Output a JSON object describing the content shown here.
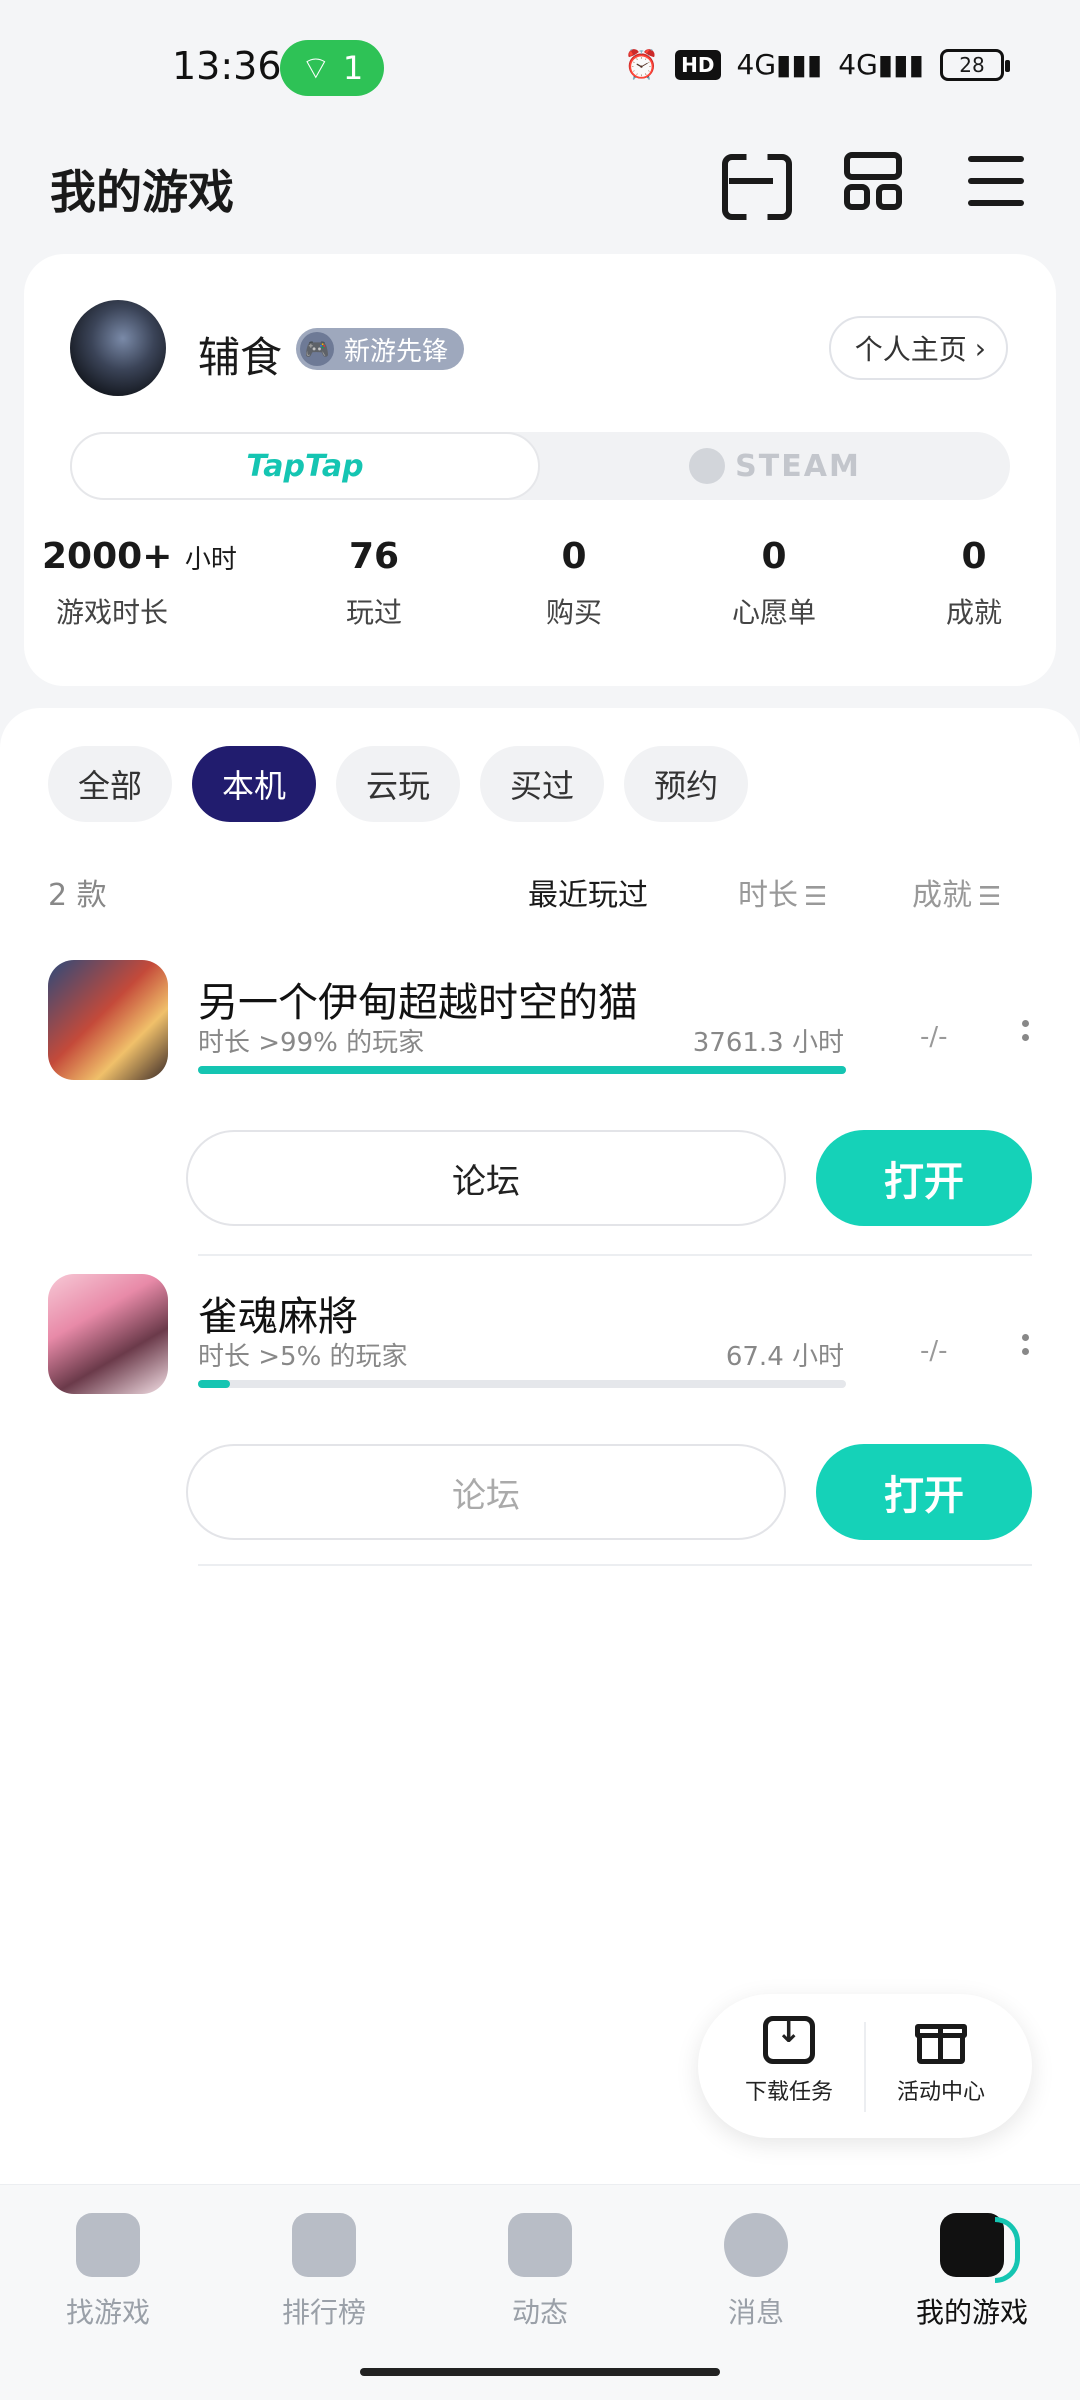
{
  "status_bar": {
    "time": "13:36",
    "hotspot_count": "1",
    "hd_label": "HD",
    "net1": "4G",
    "net2": "4G",
    "battery": "28"
  },
  "header": {
    "title": "我的游戏",
    "icons": [
      "scan-icon",
      "grid-icon",
      "menu-icon"
    ]
  },
  "profile": {
    "username": "辅食",
    "badge": "新游先锋",
    "homepage_label": "个人主页",
    "platform_tabs": [
      "TapTap",
      "STEAM"
    ],
    "active_platform": "TapTap",
    "stats": [
      {
        "value": "2000+",
        "unit": "小时",
        "label": "游戏时长"
      },
      {
        "value": "76",
        "unit": "",
        "label": "玩过"
      },
      {
        "value": "0",
        "unit": "",
        "label": "购买"
      },
      {
        "value": "0",
        "unit": "",
        "label": "心愿单"
      },
      {
        "value": "0",
        "unit": "",
        "label": "成就"
      }
    ]
  },
  "filters": {
    "chips": [
      "全部",
      "本机",
      "云玩",
      "买过",
      "预约"
    ],
    "active": "本机"
  },
  "list": {
    "count": "2 款",
    "sort_recent": "最近玩过",
    "sort_duration": "时长",
    "sort_achievement": "成就"
  },
  "games": [
    {
      "name": "另一个伊甸超越时空的猫",
      "rank_text": "时长 >99% 的玩家",
      "hours": "3761.3 小时",
      "achievement": "-/-",
      "progress": 1.0,
      "forum_label": "论坛",
      "open_label": "打开"
    },
    {
      "name": "雀魂麻將",
      "rank_text": "时长 >5% 的玩家",
      "hours": "67.4 小时",
      "achievement": "-/-",
      "progress": 0.05,
      "forum_label": "论坛",
      "open_label": "打开"
    }
  ],
  "floating": {
    "download": "下载任务",
    "activity": "活动中心"
  },
  "nav": {
    "items": [
      "找游戏",
      "排行榜",
      "动态",
      "消息",
      "我的游戏"
    ],
    "active": "我的游戏"
  }
}
